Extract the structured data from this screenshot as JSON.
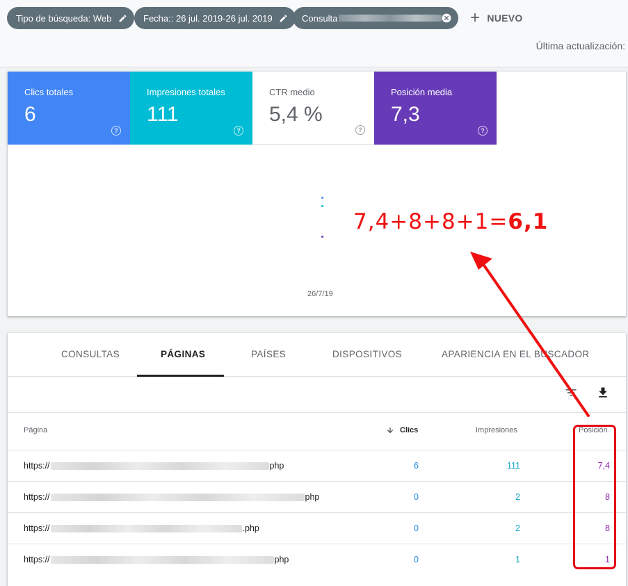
{
  "filters": {
    "chips": [
      {
        "label": "Tipo de búsqueda: Web"
      },
      {
        "label": "Fecha:: 26 jul. 2019-26 jul. 2019"
      },
      {
        "label": "Consulta"
      }
    ],
    "new_label": "NUEVO",
    "last_update": "Última actualización:"
  },
  "metrics": [
    {
      "label": "Clics totales",
      "value": "6",
      "color": "#4285f4"
    },
    {
      "label": "Impresiones totales",
      "value": "111",
      "color": "#00bcd4"
    },
    {
      "label": "CTR medio",
      "value": "5,4 %",
      "color": "#ffffff"
    },
    {
      "label": "Posición media",
      "value": "7,3",
      "color": "#673ab7"
    }
  ],
  "chart": {
    "x_label": "26/7/19",
    "formula": "7,4+8+8+1=",
    "formula_result": "6,1"
  },
  "tabs": [
    {
      "label": "CONSULTAS"
    },
    {
      "label": "PÁGINAS",
      "active": true
    },
    {
      "label": "PAÍSES"
    },
    {
      "label": "DISPOSITIVOS"
    },
    {
      "label": "APARIENCIA EN EL BUSCADOR"
    }
  ],
  "table": {
    "headers": {
      "page": "Página",
      "clicks": "Clics",
      "impressions": "Impresiones",
      "position": "Posición"
    },
    "rows": [
      {
        "prefix": "https://",
        "suffix": "php",
        "clicks": "6",
        "impressions": "111",
        "position": "7,4"
      },
      {
        "prefix": "https://",
        "suffix": "php",
        "clicks": "0",
        "impressions": "2",
        "position": "8"
      },
      {
        "prefix": "https://",
        "suffix": ".php",
        "clicks": "0",
        "impressions": "2",
        "position": "8"
      },
      {
        "prefix": "https://",
        "suffix": "php",
        "clicks": "0",
        "impressions": "1",
        "position": "1"
      }
    ]
  },
  "colors": {
    "annotation_red": "#e50914",
    "position_purple": "#8e24aa",
    "clicks_blue": "#1e88e5",
    "impressions_cyan": "#12a4c4"
  }
}
